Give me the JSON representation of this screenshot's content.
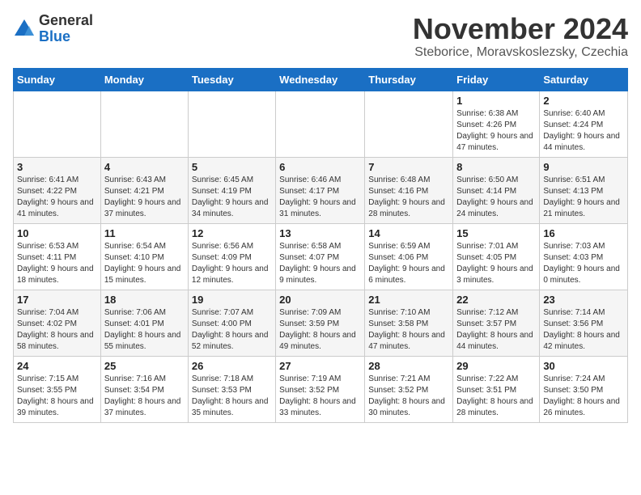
{
  "logo": {
    "general": "General",
    "blue": "Blue"
  },
  "title": "November 2024",
  "location": "Steborice, Moravskoslezsky, Czechia",
  "days_of_week": [
    "Sunday",
    "Monday",
    "Tuesday",
    "Wednesday",
    "Thursday",
    "Friday",
    "Saturday"
  ],
  "weeks": [
    [
      {
        "day": "",
        "info": ""
      },
      {
        "day": "",
        "info": ""
      },
      {
        "day": "",
        "info": ""
      },
      {
        "day": "",
        "info": ""
      },
      {
        "day": "",
        "info": ""
      },
      {
        "day": "1",
        "info": "Sunrise: 6:38 AM\nSunset: 4:26 PM\nDaylight: 9 hours and 47 minutes."
      },
      {
        "day": "2",
        "info": "Sunrise: 6:40 AM\nSunset: 4:24 PM\nDaylight: 9 hours and 44 minutes."
      }
    ],
    [
      {
        "day": "3",
        "info": "Sunrise: 6:41 AM\nSunset: 4:22 PM\nDaylight: 9 hours and 41 minutes."
      },
      {
        "day": "4",
        "info": "Sunrise: 6:43 AM\nSunset: 4:21 PM\nDaylight: 9 hours and 37 minutes."
      },
      {
        "day": "5",
        "info": "Sunrise: 6:45 AM\nSunset: 4:19 PM\nDaylight: 9 hours and 34 minutes."
      },
      {
        "day": "6",
        "info": "Sunrise: 6:46 AM\nSunset: 4:17 PM\nDaylight: 9 hours and 31 minutes."
      },
      {
        "day": "7",
        "info": "Sunrise: 6:48 AM\nSunset: 4:16 PM\nDaylight: 9 hours and 28 minutes."
      },
      {
        "day": "8",
        "info": "Sunrise: 6:50 AM\nSunset: 4:14 PM\nDaylight: 9 hours and 24 minutes."
      },
      {
        "day": "9",
        "info": "Sunrise: 6:51 AM\nSunset: 4:13 PM\nDaylight: 9 hours and 21 minutes."
      }
    ],
    [
      {
        "day": "10",
        "info": "Sunrise: 6:53 AM\nSunset: 4:11 PM\nDaylight: 9 hours and 18 minutes."
      },
      {
        "day": "11",
        "info": "Sunrise: 6:54 AM\nSunset: 4:10 PM\nDaylight: 9 hours and 15 minutes."
      },
      {
        "day": "12",
        "info": "Sunrise: 6:56 AM\nSunset: 4:09 PM\nDaylight: 9 hours and 12 minutes."
      },
      {
        "day": "13",
        "info": "Sunrise: 6:58 AM\nSunset: 4:07 PM\nDaylight: 9 hours and 9 minutes."
      },
      {
        "day": "14",
        "info": "Sunrise: 6:59 AM\nSunset: 4:06 PM\nDaylight: 9 hours and 6 minutes."
      },
      {
        "day": "15",
        "info": "Sunrise: 7:01 AM\nSunset: 4:05 PM\nDaylight: 9 hours and 3 minutes."
      },
      {
        "day": "16",
        "info": "Sunrise: 7:03 AM\nSunset: 4:03 PM\nDaylight: 9 hours and 0 minutes."
      }
    ],
    [
      {
        "day": "17",
        "info": "Sunrise: 7:04 AM\nSunset: 4:02 PM\nDaylight: 8 hours and 58 minutes."
      },
      {
        "day": "18",
        "info": "Sunrise: 7:06 AM\nSunset: 4:01 PM\nDaylight: 8 hours and 55 minutes."
      },
      {
        "day": "19",
        "info": "Sunrise: 7:07 AM\nSunset: 4:00 PM\nDaylight: 8 hours and 52 minutes."
      },
      {
        "day": "20",
        "info": "Sunrise: 7:09 AM\nSunset: 3:59 PM\nDaylight: 8 hours and 49 minutes."
      },
      {
        "day": "21",
        "info": "Sunrise: 7:10 AM\nSunset: 3:58 PM\nDaylight: 8 hours and 47 minutes."
      },
      {
        "day": "22",
        "info": "Sunrise: 7:12 AM\nSunset: 3:57 PM\nDaylight: 8 hours and 44 minutes."
      },
      {
        "day": "23",
        "info": "Sunrise: 7:14 AM\nSunset: 3:56 PM\nDaylight: 8 hours and 42 minutes."
      }
    ],
    [
      {
        "day": "24",
        "info": "Sunrise: 7:15 AM\nSunset: 3:55 PM\nDaylight: 8 hours and 39 minutes."
      },
      {
        "day": "25",
        "info": "Sunrise: 7:16 AM\nSunset: 3:54 PM\nDaylight: 8 hours and 37 minutes."
      },
      {
        "day": "26",
        "info": "Sunrise: 7:18 AM\nSunset: 3:53 PM\nDaylight: 8 hours and 35 minutes."
      },
      {
        "day": "27",
        "info": "Sunrise: 7:19 AM\nSunset: 3:52 PM\nDaylight: 8 hours and 33 minutes."
      },
      {
        "day": "28",
        "info": "Sunrise: 7:21 AM\nSunset: 3:52 PM\nDaylight: 8 hours and 30 minutes."
      },
      {
        "day": "29",
        "info": "Sunrise: 7:22 AM\nSunset: 3:51 PM\nDaylight: 8 hours and 28 minutes."
      },
      {
        "day": "30",
        "info": "Sunrise: 7:24 AM\nSunset: 3:50 PM\nDaylight: 8 hours and 26 minutes."
      }
    ]
  ]
}
